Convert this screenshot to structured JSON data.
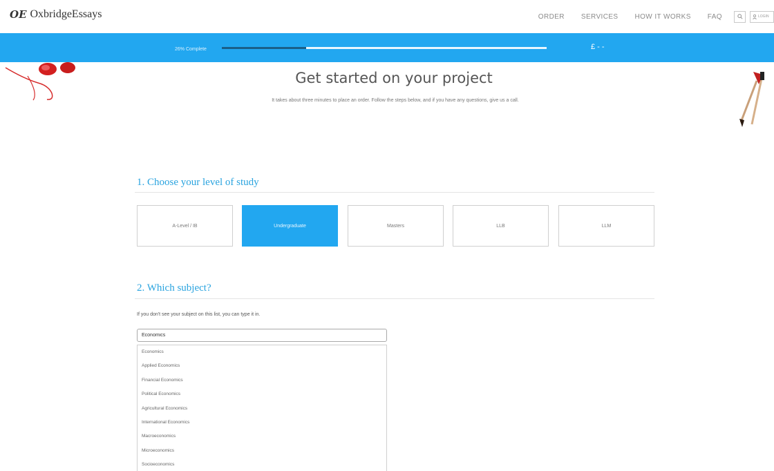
{
  "header": {
    "logo_text": "OxbridgeEssays",
    "logo_mark": "OE",
    "nav": [
      "ORDER",
      "SERVICES",
      "HOW IT WORKS",
      "FAQ"
    ],
    "search_icon": "search-icon",
    "login_label": "LOGIN"
  },
  "progress": {
    "label": "26% Complete",
    "percent": 26,
    "price": "£ - -"
  },
  "hero": {
    "title": "Get started on your project",
    "subtitle": "It takes about three minutes to place an order. Follow the steps below, and if you have any questions, give us a call."
  },
  "step1": {
    "title": "1. Choose your level of study",
    "options": [
      "A-Level / IB",
      "Undergraduate",
      "Masters",
      "LLB",
      "LLM"
    ],
    "selected": "Undergraduate"
  },
  "step2": {
    "title": "2. Which subject?",
    "hint": "If you don't see your subject on this list, you can type it in.",
    "input_value": "Economics",
    "suggestions": [
      "Economics",
      "Applied Economics",
      "Financial Economics",
      "Political Economics",
      "Agricultural Economics",
      "International Economics",
      "Macroeconomics",
      "Microeconomics",
      "Socioeconomics"
    ]
  },
  "colors": {
    "accent": "#22a7f0",
    "progress_fill": "#1a5f88",
    "heading_blue": "#29a3df"
  }
}
